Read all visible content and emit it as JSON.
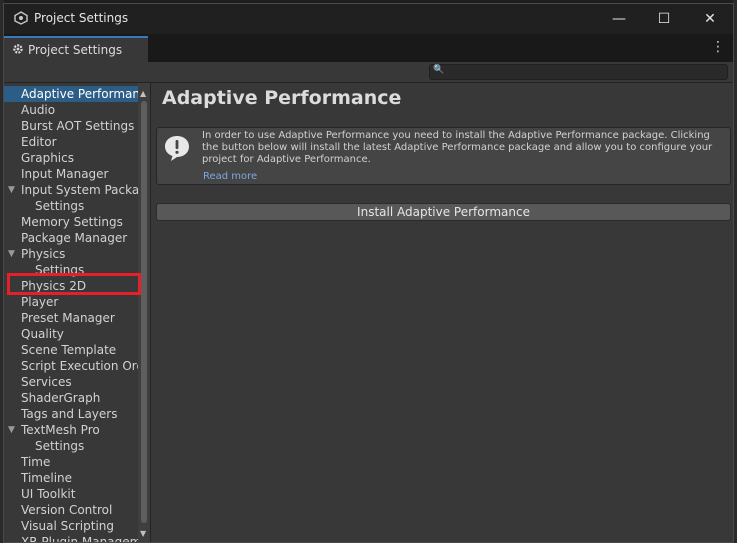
{
  "window": {
    "title": "Project Settings",
    "minimize_glyph": "—",
    "maximize_glyph": "☐",
    "close_glyph": "✕"
  },
  "tab": {
    "label": "Project Settings",
    "icon": "gear-icon",
    "menu_glyph": "⋮"
  },
  "search": {
    "placeholder": "",
    "icon_glyph": "🔍"
  },
  "sidebar": {
    "items": [
      {
        "label": "Adaptive Performance",
        "selected": true
      },
      {
        "label": "Audio"
      },
      {
        "label": "Burst AOT Settings"
      },
      {
        "label": "Editor"
      },
      {
        "label": "Graphics"
      },
      {
        "label": "Input Manager"
      },
      {
        "label": "Input System Package",
        "expandable": true
      },
      {
        "label": "Settings",
        "child": true
      },
      {
        "label": "Memory Settings"
      },
      {
        "label": "Package Manager"
      },
      {
        "label": "Physics",
        "expandable": true
      },
      {
        "label": "Settings",
        "child": true
      },
      {
        "label": "Physics 2D",
        "highlighted": true
      },
      {
        "label": "Player"
      },
      {
        "label": "Preset Manager"
      },
      {
        "label": "Quality"
      },
      {
        "label": "Scene Template"
      },
      {
        "label": "Script Execution Order"
      },
      {
        "label": "Services"
      },
      {
        "label": "ShaderGraph"
      },
      {
        "label": "Tags and Layers"
      },
      {
        "label": "TextMesh Pro",
        "expandable": true
      },
      {
        "label": "Settings",
        "child": true
      },
      {
        "label": "Time"
      },
      {
        "label": "Timeline"
      },
      {
        "label": "UI Toolkit"
      },
      {
        "label": "Version Control"
      },
      {
        "label": "Visual Scripting"
      },
      {
        "label": "XR Plugin Management"
      }
    ],
    "fold_glyph": "▼"
  },
  "content": {
    "title": "Adaptive Performance",
    "help_text": "In order to use Adaptive Performance you need to install the Adaptive Performance package. Clicking the button below will install the latest Adaptive Performance package and allow you to configure your project for Adaptive Performance.",
    "read_more": "Read more",
    "install_button": "Install Adaptive Performance"
  },
  "colors": {
    "selection": "#2c5d87",
    "highlight_box": "#e5202a",
    "link": "#7aa9e0",
    "tab_accent": "#3a79bb"
  }
}
